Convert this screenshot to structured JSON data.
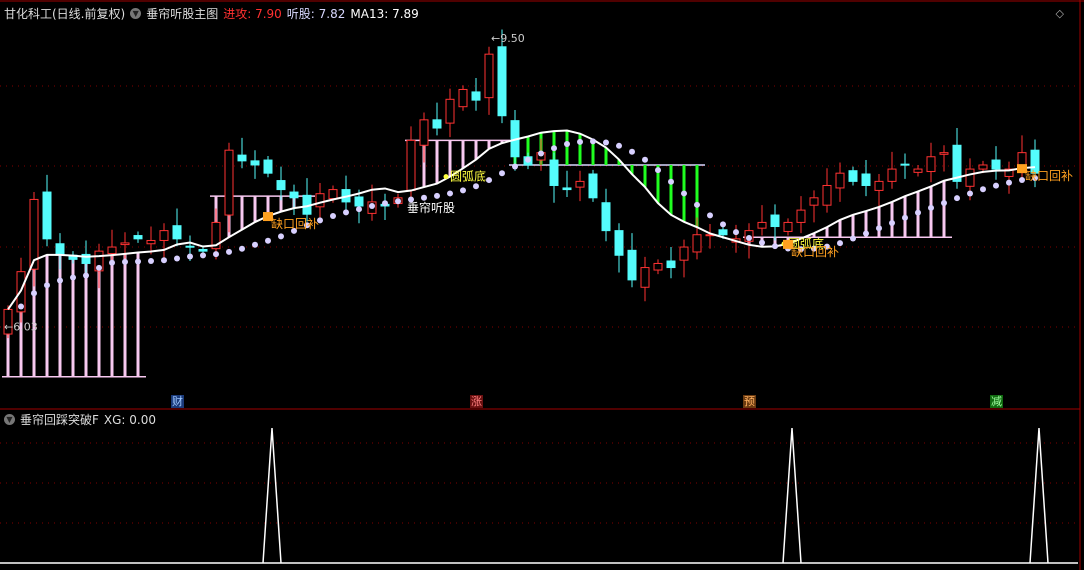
{
  "header": {
    "stock": "甘化科工(日线.前复权)",
    "indicator": "垂帘听股主图",
    "attack_label": "进攻:",
    "attack_value": "7.90",
    "listen_label": "听股:",
    "listen_value": "7.82",
    "ma_label": "MA13:",
    "ma_value": "7.89"
  },
  "sub_header": {
    "indicator": "垂帘回踩突破F",
    "xg_label": "XG:",
    "xg_value": "0.00"
  },
  "colors": {
    "up": "#ff3232",
    "down": "#54fcfc",
    "ma": "#ffffff",
    "dots": "#d8d0ff",
    "pink": "#f8c8f0",
    "green": "#20ff20",
    "label": "#ffa020",
    "yellow": "#ffff40"
  },
  "chart_data": [
    {
      "type": "candlestick",
      "title": "垂帘听股主图",
      "ylim": [
        5.38,
        10.01
      ],
      "closes": [
        6.24,
        6.7,
        7.58,
        7.1,
        6.9,
        6.85,
        6.8,
        6.95,
        7.0,
        7.05,
        7.1,
        7.08,
        7.2,
        7.1,
        7.0,
        6.95,
        7.3,
        8.18,
        8.05,
        8.0,
        7.9,
        7.7,
        7.6,
        7.4,
        7.65,
        7.7,
        7.55,
        7.5,
        7.55,
        7.5,
        7.6,
        8.3,
        8.55,
        8.45,
        8.8,
        8.92,
        8.79,
        9.35,
        8.6,
        8.1,
        8.0,
        8.15,
        7.75,
        7.7,
        7.8,
        7.6,
        7.2,
        6.9,
        6.6,
        6.75,
        6.8,
        6.75,
        7.0,
        7.15,
        7.15,
        7.15,
        7.1,
        7.2,
        7.3,
        7.25,
        7.3,
        7.45,
        7.6,
        7.75,
        7.9,
        7.8,
        7.75,
        7.8,
        7.95,
        8.0,
        7.95,
        8.1,
        8.15,
        7.8,
        7.95,
        8.0,
        7.95,
        7.95,
        8.15,
        7.9
      ],
      "ma_period": 13,
      "price_labels": [
        {
          "index": 0,
          "text": "←6.03",
          "price": 6.03
        },
        {
          "index": 37,
          "text": "←9.50",
          "price": 9.5
        }
      ],
      "zones": [
        {
          "color": "pink",
          "start": 0,
          "end": 10,
          "base": 5.42
        },
        {
          "color": "pink",
          "start": 16,
          "end": 23,
          "base": 7.62
        },
        {
          "color": "pink",
          "start": 31,
          "end": 38,
          "base": 8.3
        },
        {
          "color": "green",
          "start": 39,
          "end": 53,
          "base": 8.0
        },
        {
          "color": "pink",
          "start": 57,
          "end": 72,
          "base": 7.12
        }
      ],
      "signals": [
        {
          "index": 20,
          "text": "缺口回补",
          "kind": "gap"
        },
        {
          "index": 34,
          "text": "圆弧底",
          "kind": "arc"
        },
        {
          "index": 60,
          "text": "圆弧底",
          "kind": "arc"
        },
        {
          "index": 60,
          "text": "缺口回补",
          "kind": "gap"
        },
        {
          "index": 78,
          "text": "缺口回补",
          "kind": "gap"
        }
      ],
      "annotation": {
        "index": 31,
        "text": "垂帘听股"
      },
      "markers": [
        {
          "index": 13,
          "text": "财",
          "bg": "#1a3a7a",
          "fg": "#a0c8ff"
        },
        {
          "index": 36,
          "text": "涨",
          "bg": "#6a1010",
          "fg": "#ff8080"
        },
        {
          "index": 57,
          "text": "预",
          "bg": "#6a3a10",
          "fg": "#ffb060"
        },
        {
          "index": 76,
          "text": "减",
          "bg": "#106a10",
          "fg": "#a0ffa0"
        }
      ]
    },
    {
      "type": "line",
      "title": "垂帘回踩突破F",
      "series": [
        {
          "name": "XG",
          "spikes": [
            20,
            60,
            79
          ],
          "values_range": [
            0,
            1
          ]
        }
      ]
    }
  ]
}
